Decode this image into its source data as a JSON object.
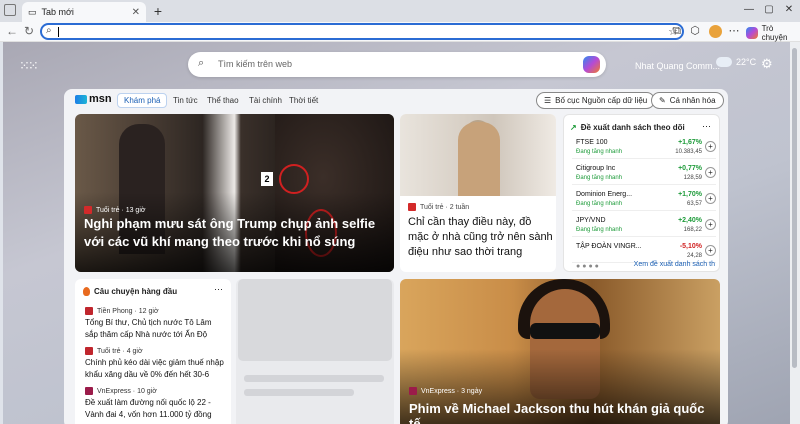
{
  "browser": {
    "tab_title": "Tab mới",
    "copilot_label": "Trò chuyện"
  },
  "newtab": {
    "search_placeholder": "Tìm kiếm trên web",
    "user_name": "Nhat Quang Comm...",
    "temperature": "22°C"
  },
  "feed": {
    "logo": "msn",
    "active_tab": "Khám phá",
    "nav": [
      "Tin tức",
      "Thể thao",
      "Tài chính",
      "Thời tiết"
    ],
    "layout_button": "Bố cục Nguồn cấp dữ liệu",
    "personalize_button": "Cá nhân hóa"
  },
  "hero": {
    "source": "Tuổi trẻ · 13 giờ",
    "title": "Nghi phạm mưu sát ông Trump chụp ảnh selfie với các vũ khí mang theo trước khi nổ súng",
    "badge": "2"
  },
  "mid_card": {
    "source": "Tuổi trẻ · 2 tuần",
    "title": "Chỉ cần thay điều này, đồ mặc ở nhà cũng trở nên sành điệu như sao thời trang"
  },
  "stocks": {
    "header": "Đề xuất danh sách theo dõi",
    "rows": [
      {
        "name": "FTSE 100",
        "sub": "Đang tăng nhanh",
        "pct": "+1,67%",
        "value": "10.383,45",
        "up": true
      },
      {
        "name": "Citigroup Inc",
        "sub": "Đang tăng nhanh",
        "pct": "+0,77%",
        "value": "128,59",
        "up": true
      },
      {
        "name": "Dominion Energ...",
        "sub": "Đang tăng nhanh",
        "pct": "+1,70%",
        "value": "63,57",
        "up": true
      },
      {
        "name": "JPY/VND",
        "sub": "Đang tăng nhanh",
        "pct": "+2,40%",
        "value": "168,22",
        "up": true
      },
      {
        "name": "TẬP ĐOÀN VINGR...",
        "sub": "",
        "pct": "-5,10%",
        "value": "24,28",
        "up": false
      }
    ],
    "more_link": "Xem đề xuất danh sách th"
  },
  "top_stories": {
    "header": "Câu chuyện hàng đầu",
    "items": [
      {
        "source": "Tiền Phong · 12 giờ",
        "title": "Tổng Bí thư, Chủ tịch nước Tô Lâm sắp thăm cấp Nhà nước tới Ấn Độ",
        "color": "#c0262d"
      },
      {
        "source": "Tuổi trẻ · 4 giờ",
        "title": "Chính phủ kéo dài việc giảm thuế nhập khẩu xăng dầu về 0% đến hết 30-6",
        "color": "#c0262d"
      },
      {
        "source": "VnExpress · 10 giờ",
        "title": "Đề xuất làm đường nối quốc lộ 22 - Vành đai 4, vốn hơn 11.000 tỷ đồng",
        "color": "#9b1c4a"
      }
    ]
  },
  "mj_card": {
    "source": "VnExpress · 3 ngày",
    "title": "Phim về Michael Jackson thu hút khán giả quốc tế"
  },
  "colors": {
    "accent": "#2b6cd4",
    "positive": "#1e9b3a",
    "negative": "#d02020"
  }
}
